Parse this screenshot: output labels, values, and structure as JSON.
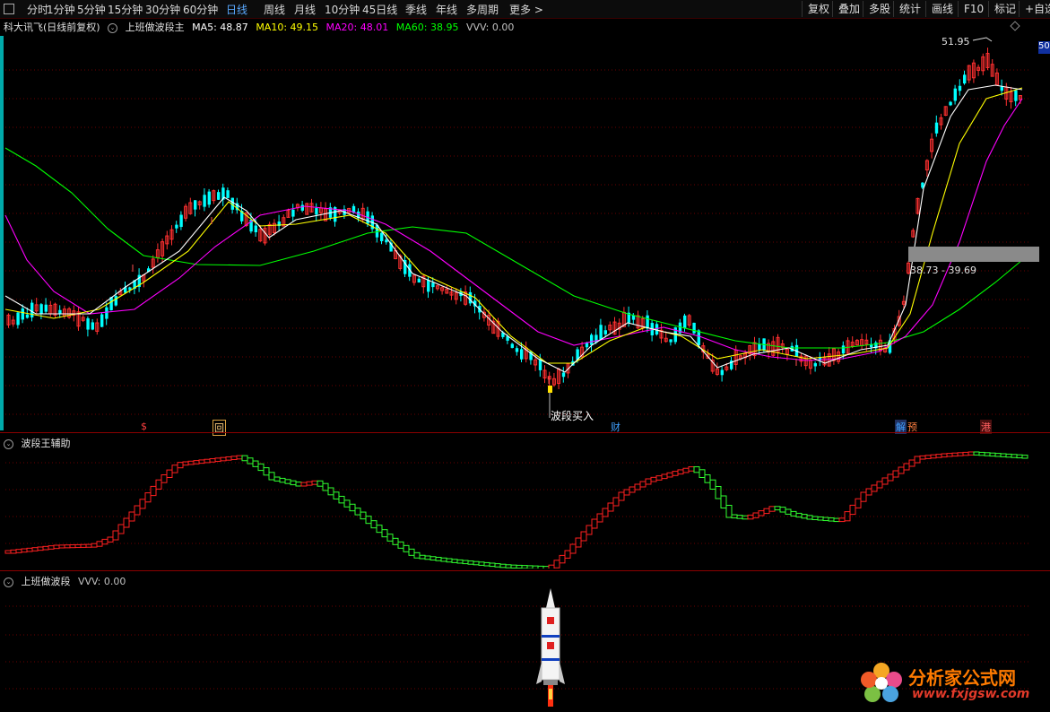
{
  "toolbar": {
    "periods": [
      "分时",
      "1分钟",
      "5分钟",
      "15分钟",
      "30分钟",
      "60分钟",
      "日线",
      "周线",
      "月线",
      "10分钟",
      "45日线",
      "季线",
      "年线",
      "多周期",
      "更多 >"
    ],
    "active_period": "日线",
    "right_buttons": [
      "复权",
      "叠加",
      "多股",
      "统计",
      "画线",
      "F10",
      "标记",
      "+自选"
    ]
  },
  "main_panel": {
    "stock": "科大讯飞(日线前复权)",
    "indicator": "上班做波段主",
    "ma5": "MA5: 48.87",
    "ma10": "MA10: 49.15",
    "ma20": "MA20: 48.01",
    "ma60": "MA60: 38.95",
    "vvv": "VVV: 0.00",
    "high_label": "51.95",
    "low_label": "波段买入",
    "box_label": "38.73 - 39.69",
    "right_edge_label": "50",
    "signals": [
      "$",
      "回",
      "财",
      "解",
      "预",
      "港"
    ],
    "colors": {
      "ma5": "#ffffff",
      "ma10": "#ffff00",
      "ma20": "#ff00ff",
      "ma60": "#00ff00",
      "up": "#ff3030",
      "down": "#00ffff"
    }
  },
  "sub_panel1": {
    "title": "波段王辅助"
  },
  "sub_panel2": {
    "title": "上班做波段",
    "vvv": "VVV: 0.00"
  },
  "watermark": {
    "title": "分析家公式网",
    "url": "www.fxjgsw.com"
  }
}
